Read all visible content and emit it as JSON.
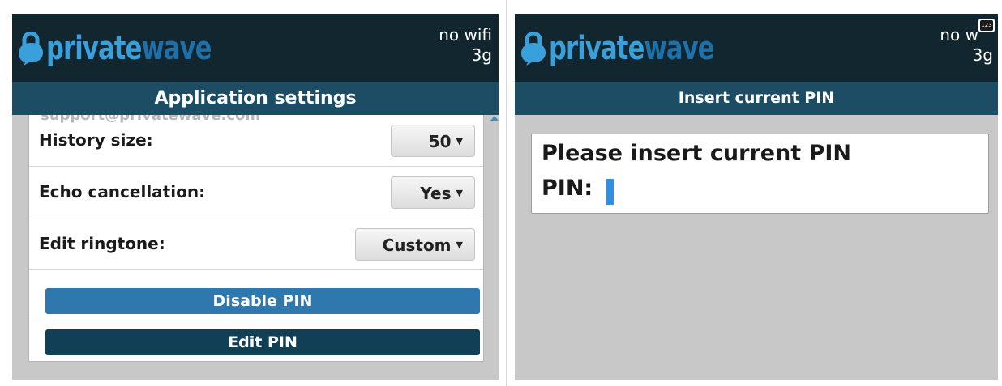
{
  "brand": {
    "part1": "private",
    "part2": "wave"
  },
  "colors": {
    "topbar": "#11262e",
    "titlebar": "#1d4d65",
    "disable_btn": "#2f78ad",
    "edit_btn": "#113f56"
  },
  "left_screen": {
    "status": {
      "wifi": "no wifi",
      "network": "3g"
    },
    "title": "Application settings",
    "clipped_text": "support@privatewave.com",
    "settings": [
      {
        "label": "History size:",
        "value": "50"
      },
      {
        "label": "Echo cancellation:",
        "value": "Yes"
      },
      {
        "label": "Edit ringtone:",
        "value": "Custom"
      }
    ],
    "buttons": {
      "disable_pin": "Disable PIN",
      "edit_pin": "Edit PIN"
    }
  },
  "right_screen": {
    "status": {
      "wifi": "no w",
      "network": "3g",
      "keyboard_icon_text": "123"
    },
    "title": "Insert current PIN",
    "dialog": {
      "prompt": "Please insert current PIN",
      "pin_label": "PIN:"
    }
  }
}
